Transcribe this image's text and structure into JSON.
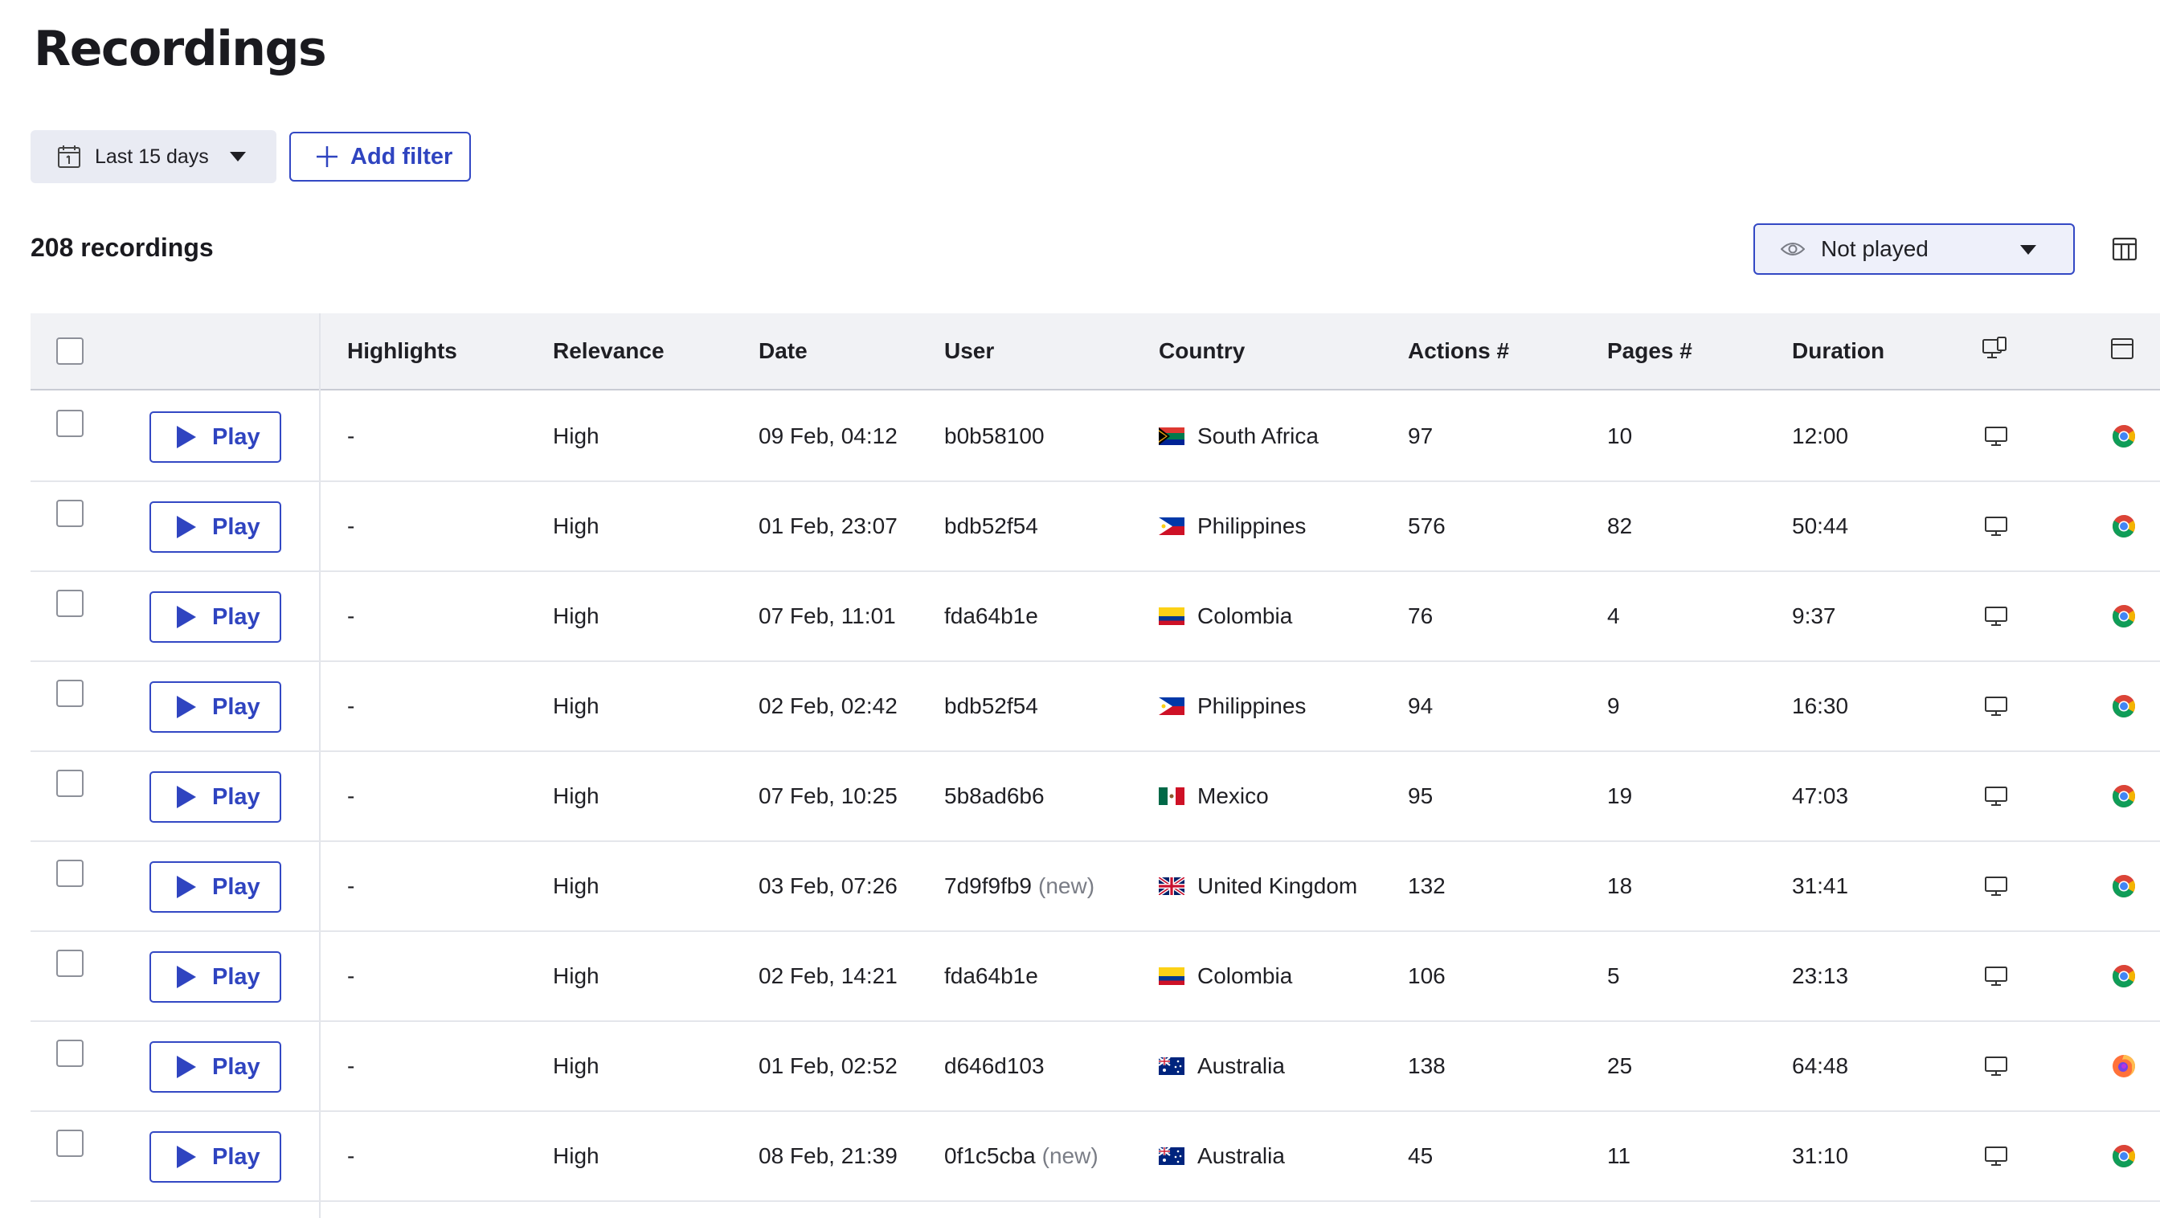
{
  "page": {
    "title": "Recordings"
  },
  "filters": {
    "date_range_label": "Last 15 days",
    "add_filter_label": "Add filter"
  },
  "summary": {
    "count_label": "208 recordings"
  },
  "played_filter": {
    "selected": "Not played"
  },
  "table": {
    "columns": {
      "highlights": "Highlights",
      "relevance": "Relevance",
      "date": "Date",
      "user": "User",
      "country": "Country",
      "actions": "Actions #",
      "pages": "Pages #",
      "duration": "Duration"
    },
    "play_label": "Play",
    "rows": [
      {
        "highlights": "-",
        "relevance": "High",
        "date": "09 Feb, 04:12",
        "user": "b0b58100",
        "new": "",
        "flag": "za",
        "country": "South Africa",
        "actions": "97",
        "pages": "10",
        "duration": "12:00",
        "device": "desktop-icon",
        "browser": "chrome-icon"
      },
      {
        "highlights": "-",
        "relevance": "High",
        "date": "01 Feb, 23:07",
        "user": "bdb52f54",
        "new": "",
        "flag": "ph",
        "country": "Philippines",
        "actions": "576",
        "pages": "82",
        "duration": "50:44",
        "device": "desktop-icon",
        "browser": "chrome-icon"
      },
      {
        "highlights": "-",
        "relevance": "High",
        "date": "07 Feb, 11:01",
        "user": "fda64b1e",
        "new": "",
        "flag": "co",
        "country": "Colombia",
        "actions": "76",
        "pages": "4",
        "duration": "9:37",
        "device": "desktop-icon",
        "browser": "chrome-icon"
      },
      {
        "highlights": "-",
        "relevance": "High",
        "date": "02 Feb, 02:42",
        "user": "bdb52f54",
        "new": "",
        "flag": "ph",
        "country": "Philippines",
        "actions": "94",
        "pages": "9",
        "duration": "16:30",
        "device": "desktop-icon",
        "browser": "chrome-icon"
      },
      {
        "highlights": "-",
        "relevance": "High",
        "date": "07 Feb, 10:25",
        "user": "5b8ad6b6",
        "new": "",
        "flag": "mx",
        "country": "Mexico",
        "actions": "95",
        "pages": "19",
        "duration": "47:03",
        "device": "desktop-icon",
        "browser": "chrome-icon"
      },
      {
        "highlights": "-",
        "relevance": "High",
        "date": "03 Feb, 07:26",
        "user": "7d9f9fb9",
        "new": "(new)",
        "flag": "gb",
        "country": "United Kingdom",
        "actions": "132",
        "pages": "18",
        "duration": "31:41",
        "device": "desktop-icon",
        "browser": "chrome-icon"
      },
      {
        "highlights": "-",
        "relevance": "High",
        "date": "02 Feb, 14:21",
        "user": "fda64b1e",
        "new": "",
        "flag": "co",
        "country": "Colombia",
        "actions": "106",
        "pages": "5",
        "duration": "23:13",
        "device": "desktop-icon",
        "browser": "chrome-icon"
      },
      {
        "highlights": "-",
        "relevance": "High",
        "date": "01 Feb, 02:52",
        "user": "d646d103",
        "new": "",
        "flag": "au",
        "country": "Australia",
        "actions": "138",
        "pages": "25",
        "duration": "64:48",
        "device": "desktop-icon",
        "browser": "firefox-icon"
      },
      {
        "highlights": "-",
        "relevance": "High",
        "date": "08 Feb, 21:39",
        "user": "0f1c5cba",
        "new": "(new)",
        "flag": "au",
        "country": "Australia",
        "actions": "45",
        "pages": "11",
        "duration": "31:10",
        "device": "desktop-icon",
        "browser": "chrome-icon"
      }
    ]
  },
  "colors": {
    "accent": "#2f44c0",
    "header_bg": "#f1f2f5",
    "select_bg": "#eef0fa",
    "date_bg": "#e9ebf3"
  }
}
